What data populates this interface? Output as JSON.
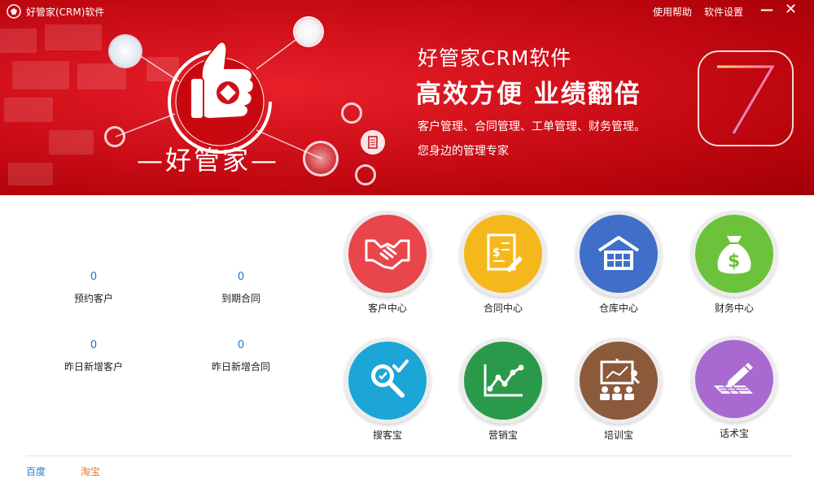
{
  "window": {
    "title": "好管家(CRM)软件",
    "help_label": "使用帮助",
    "settings_label": "软件设置",
    "minimize_glyph": "—",
    "close_glyph": "✕"
  },
  "banner": {
    "brand_text": "—好管家—",
    "product_name": "好管家CRM软件",
    "slogan": "高效方便 业绩翻倍",
    "features": "客户管理、合同管理、工单管理、财务管理。",
    "tagline": "您身边的管理专家",
    "version_badge": "7",
    "icons": [
      "thumbs-up-icon",
      "globe-icon",
      "network-icon",
      "document-icon"
    ]
  },
  "stats": [
    {
      "value": "0",
      "label": "预约客户"
    },
    {
      "value": "0",
      "label": "到期合同"
    },
    {
      "value": "0",
      "label": "昨日新增客户"
    },
    {
      "value": "0",
      "label": "昨日新增合同"
    }
  ],
  "modules": [
    {
      "label": "客户中心",
      "color": "#e8464a",
      "icon": "handshake-icon"
    },
    {
      "label": "合同中心",
      "color": "#f4b81c",
      "icon": "contract-icon"
    },
    {
      "label": "仓库中心",
      "color": "#3f6fc8",
      "icon": "warehouse-icon"
    },
    {
      "label": "财务中心",
      "color": "#6cc23a",
      "icon": "money-bag-icon"
    },
    {
      "label": "搜客宝",
      "color": "#1ca6d8",
      "icon": "search-customer-icon"
    },
    {
      "label": "营销宝",
      "color": "#2a9a4a",
      "icon": "line-chart-icon"
    },
    {
      "label": "培训宝",
      "color": "#8a5a3a",
      "icon": "training-board-icon"
    },
    {
      "label": "话术宝",
      "color": "#a86ad0",
      "icon": "keyboard-pen-icon"
    }
  ],
  "footer": {
    "links": [
      {
        "label": "百度",
        "color": "#2a7ad0"
      },
      {
        "label": "淘宝",
        "color": "#e8742a"
      }
    ]
  }
}
